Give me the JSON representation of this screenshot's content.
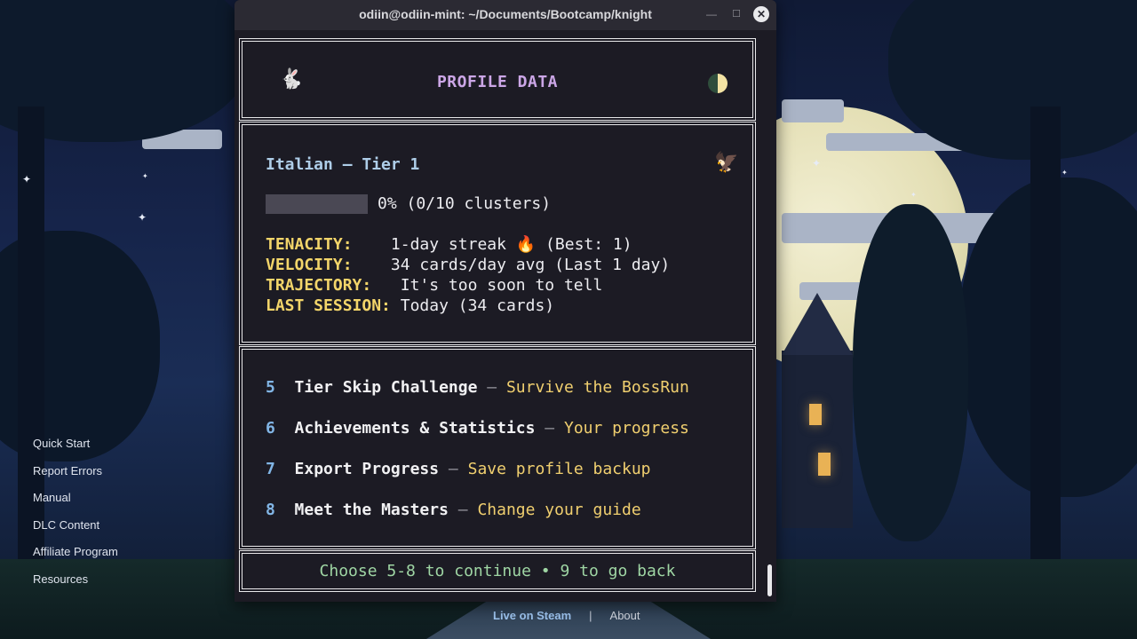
{
  "window": {
    "title": "odiin@odiin-mint: ~/Documents/Bootcamp/knight",
    "minimize_glyph": "—",
    "maximize_glyph": "☐",
    "close_glyph": "✕"
  },
  "header": {
    "title": "PROFILE DATA",
    "left_icon": "rabbit-icon",
    "right_icon": "half-moon-icon"
  },
  "profile": {
    "language_tier": "Italian – Tier 1",
    "badge_icon": "eagle-icon",
    "progress_percent": 0,
    "progress_text": "0% (0/10 clusters)",
    "stats": [
      {
        "key": "TENACITY:",
        "gap": "    ",
        "value": "1-day streak ",
        "flame": "🔥",
        "suffix": " (Best: 1)"
      },
      {
        "key": "VELOCITY:",
        "gap": "    ",
        "value": "34 cards/day avg (Last 1 day)"
      },
      {
        "key": "TRAJECTORY:",
        "gap": "   ",
        "value": "It's too soon to tell"
      },
      {
        "key": "LAST SESSION:",
        "gap": " ",
        "value": "Today (34 cards)"
      }
    ]
  },
  "menu": {
    "items": [
      {
        "num": "5",
        "label": "Tier Skip Challenge",
        "dash": " – ",
        "desc": "Survive the BossRun"
      },
      {
        "num": "6",
        "label": "Achievements & Statistics",
        "dash": " – ",
        "desc": "Your progress"
      },
      {
        "num": "7",
        "label": "Export Progress",
        "dash": " – ",
        "desc": "Save profile backup"
      },
      {
        "num": "8",
        "label": "Meet the Masters",
        "dash": " – ",
        "desc": "Change your guide"
      }
    ]
  },
  "prompt": "Choose 5-8 to continue • 9 to go back",
  "left_menu": [
    "Quick Start",
    "Report Errors",
    "Manual",
    "DLC Content",
    "Affiliate Program",
    "Resources"
  ],
  "bottom_links": {
    "steam": "Live on Steam",
    "separator": "|",
    "about": "About"
  },
  "colors": {
    "terminal_bg": "#1c1b24",
    "header_title": "#cba6e6",
    "stat_key": "#f3d56a",
    "menu_desc": "#f0cf6f",
    "menu_num": "#82b6e6",
    "prompt": "#9fd6a4"
  }
}
